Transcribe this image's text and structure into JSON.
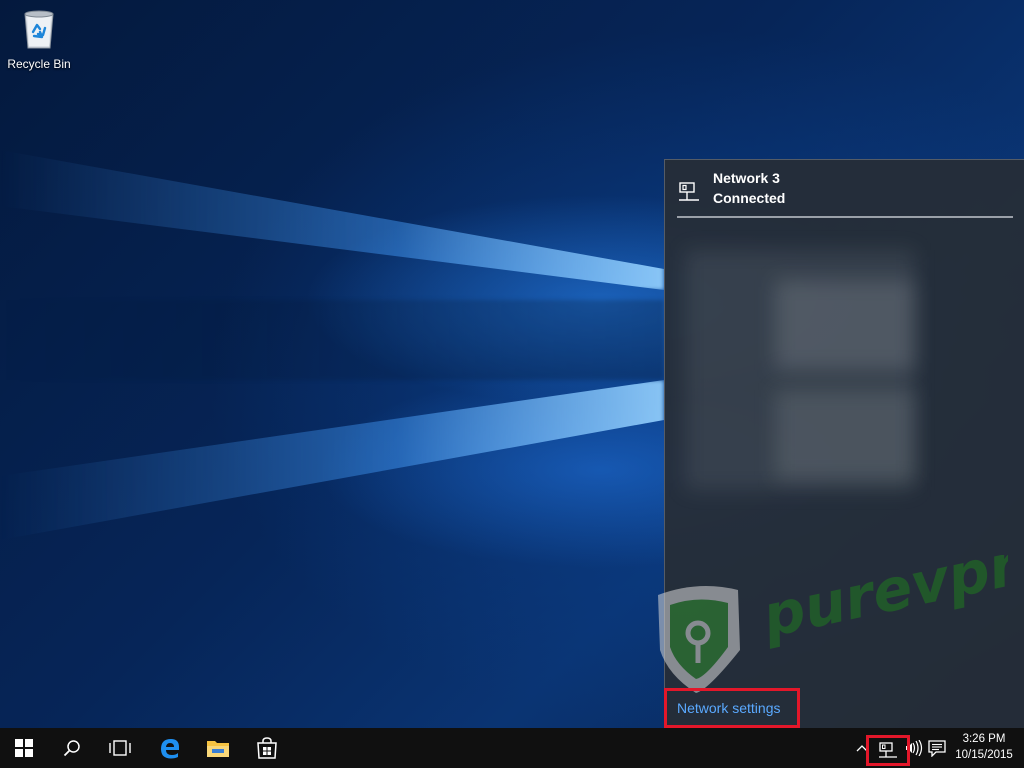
{
  "desktop": {
    "icons": [
      {
        "label": "Recycle Bin",
        "icon": "recycle-bin-icon"
      }
    ]
  },
  "network_flyout": {
    "network_name": "Network  3",
    "status": "Connected",
    "settings_link": "Network settings",
    "icon": "ethernet-network-icon"
  },
  "watermark": {
    "text": "purevpn",
    "colors": {
      "shield": "#d8d8d8",
      "p": "#2f8f2f",
      "text": "#1f7a1f"
    }
  },
  "taskbar": {
    "buttons": [
      {
        "name": "start",
        "icon": "windows-logo-icon"
      },
      {
        "name": "search",
        "icon": "search-icon"
      },
      {
        "name": "task-view",
        "icon": "task-view-icon"
      },
      {
        "name": "edge",
        "icon": "edge-browser-icon"
      },
      {
        "name": "file-explorer",
        "icon": "folder-icon"
      },
      {
        "name": "store",
        "icon": "store-icon"
      }
    ],
    "tray": {
      "show_hidden_icon": "chevron-up-icon",
      "network_icon": "ethernet-network-icon",
      "volume_icon": "volume-icon",
      "action_center_icon": "notification-icon"
    },
    "clock": {
      "time": "3:26 PM",
      "date": "10/15/2015"
    }
  },
  "colors": {
    "highlight": "#e3172a",
    "link": "#5aa9ff",
    "flyout_bg": "#272d36",
    "taskbar_bg": "#101010"
  }
}
